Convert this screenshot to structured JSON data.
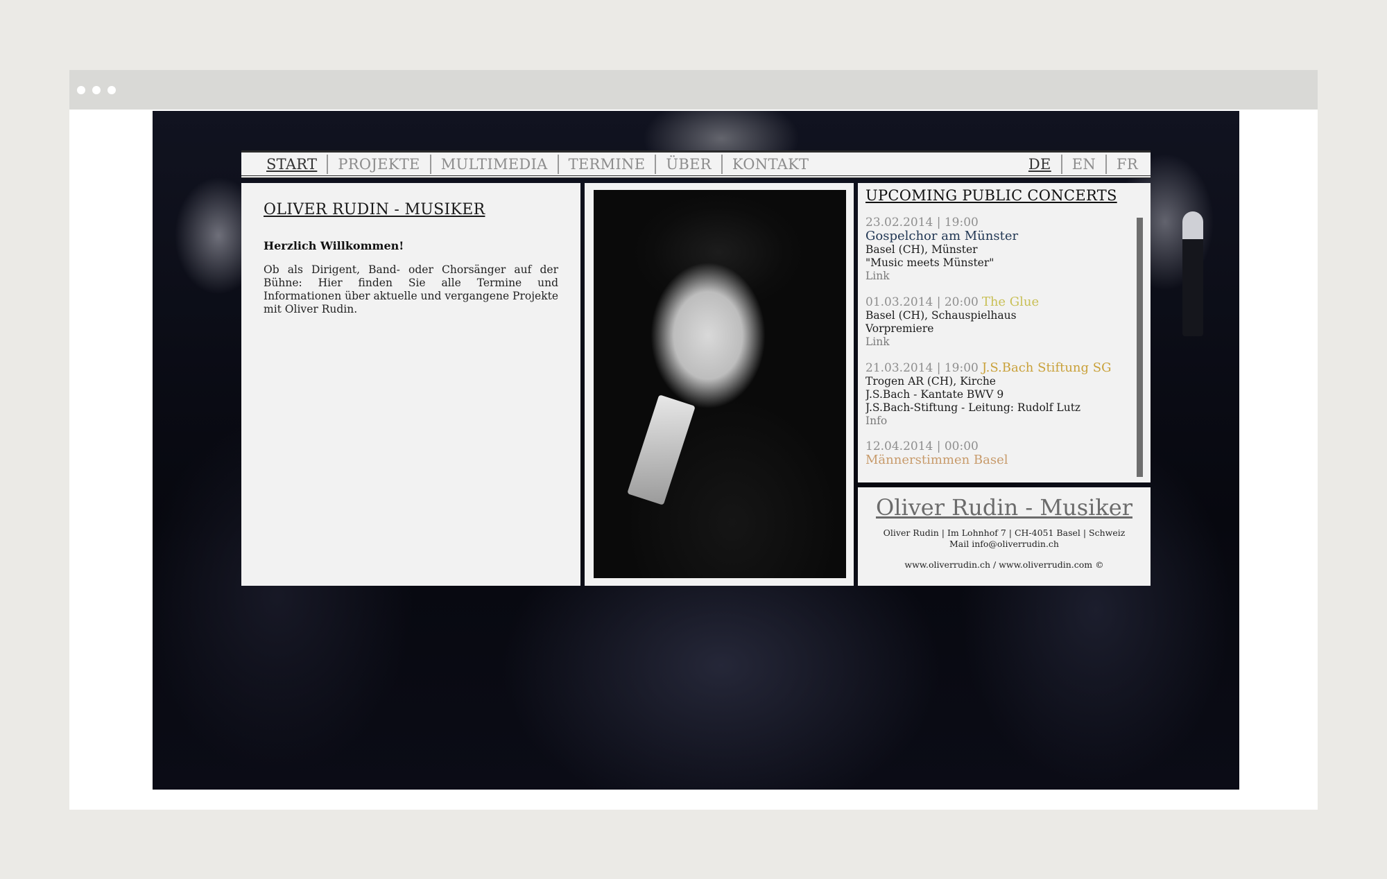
{
  "nav": {
    "items": [
      {
        "label": "START",
        "active": true
      },
      {
        "label": "PROJEKTE",
        "active": false
      },
      {
        "label": "MULTIMEDIA",
        "active": false
      },
      {
        "label": "TERMINE",
        "active": false
      },
      {
        "label": "ÜBER",
        "active": false
      },
      {
        "label": "KONTAKT",
        "active": false
      }
    ],
    "languages": [
      {
        "label": "DE",
        "active": true
      },
      {
        "label": "EN",
        "active": false
      },
      {
        "label": "FR",
        "active": false
      }
    ]
  },
  "intro": {
    "title": "OLIVER RUDIN - MUSIKER",
    "welcome": "Herzlich Willkommen!",
    "text": "Ob als Dirigent, Band- oder Chorsänger auf der Bühne: Hier finden Sie alle Termine und Informationen über aktuelle und vergangene Projekte mit Oliver Rudin."
  },
  "concerts": {
    "title": "UPCOMING PUBLIC CONCERTS",
    "items": [
      {
        "datetime": "23.02.2014 | 19:00",
        "name": "Gospelchor am Münster",
        "name_color": "#1f3552",
        "name_inline": false,
        "lines": [
          "Basel (CH), Münster",
          "\"Music meets Münster\""
        ],
        "link": "Link"
      },
      {
        "datetime": "01.03.2014 | 20:00",
        "name": "The Glue",
        "name_color": "#c8bf55",
        "name_inline": true,
        "lines": [
          "Basel (CH), Schauspielhaus",
          "Vorpremiere"
        ],
        "link": "Link"
      },
      {
        "datetime": "21.03.2014 | 19:00",
        "name": "J.S.Bach Stiftung SG",
        "name_color": "#c9a13a",
        "name_inline": true,
        "lines": [
          "Trogen AR (CH), Kirche",
          "J.S.Bach - Kantate BWV 9",
          "J.S.Bach-Stiftung - Leitung: Rudolf Lutz"
        ],
        "link": "Info"
      },
      {
        "datetime": "12.04.2014 | 00:00",
        "name": "Männerstimmen Basel",
        "name_color": "#c79a6a",
        "name_inline": false,
        "lines": [],
        "link": ""
      }
    ]
  },
  "contact": {
    "title": "Oliver Rudin - Musiker",
    "address": "Oliver Rudin | Im Lohnhof 7 | CH-4051 Basel | Schweiz",
    "mail": "Mail info@oliverrudin.ch",
    "web": "www.oliverrudin.ch / www.oliverrudin.com ©"
  }
}
